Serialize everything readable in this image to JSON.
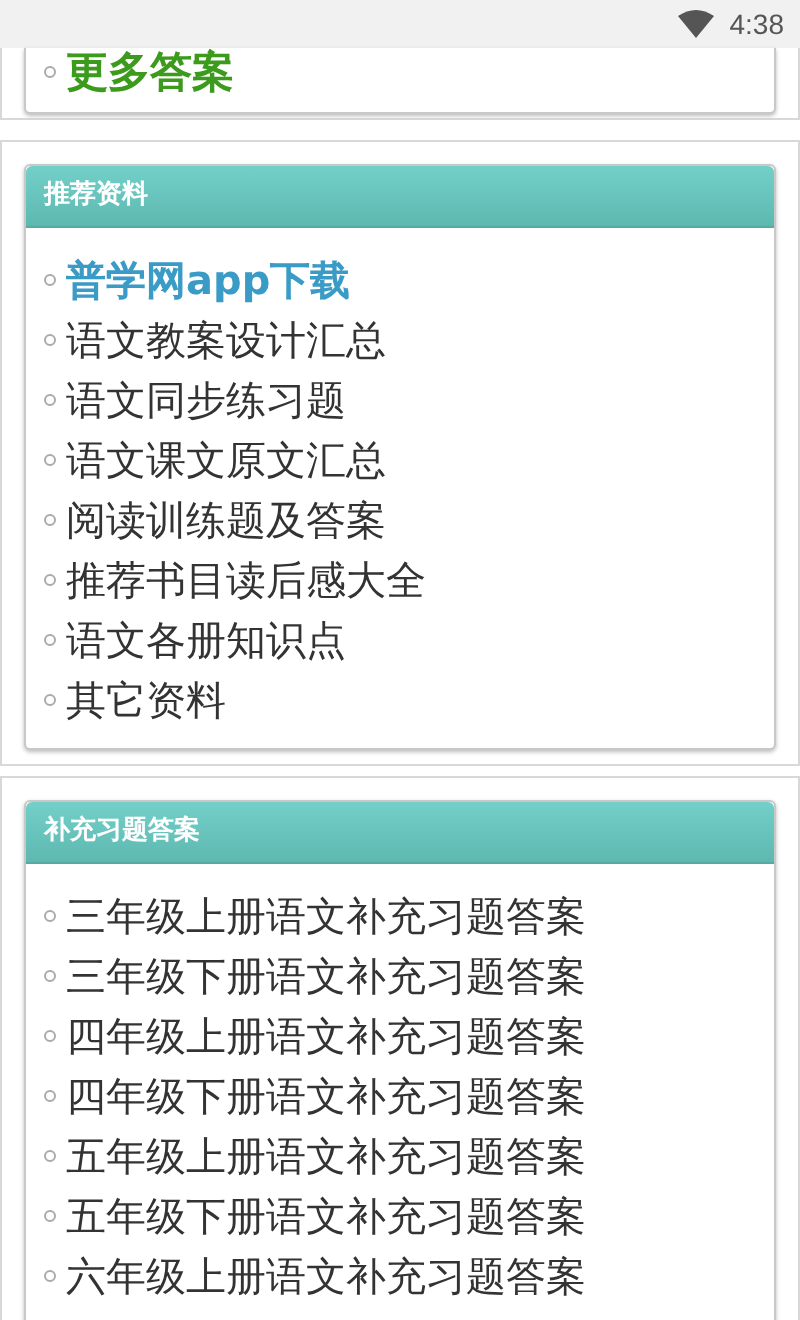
{
  "status_bar": {
    "time": "4:38"
  },
  "sections": [
    {
      "items": [
        {
          "label": "更多答案",
          "kind": "more"
        }
      ]
    },
    {
      "title": "推荐资料",
      "items": [
        {
          "label": "普学网app下载",
          "kind": "featured"
        },
        {
          "label": "语文教案设计汇总",
          "kind": "plain"
        },
        {
          "label": "语文同步练习题",
          "kind": "plain"
        },
        {
          "label": "语文课文原文汇总",
          "kind": "plain"
        },
        {
          "label": "阅读训练题及答案",
          "kind": "plain"
        },
        {
          "label": "推荐书目读后感大全",
          "kind": "plain"
        },
        {
          "label": "语文各册知识点",
          "kind": "plain"
        },
        {
          "label": "其它资料",
          "kind": "plain"
        }
      ]
    },
    {
      "title": "补充习题答案",
      "items": [
        {
          "label": "三年级上册语文补充习题答案",
          "kind": "plain"
        },
        {
          "label": "三年级下册语文补充习题答案",
          "kind": "plain"
        },
        {
          "label": "四年级上册语文补充习题答案",
          "kind": "plain"
        },
        {
          "label": "四年级下册语文补充习题答案",
          "kind": "plain"
        },
        {
          "label": "五年级上册语文补充习题答案",
          "kind": "plain"
        },
        {
          "label": "五年级下册语文补充习题答案",
          "kind": "plain"
        },
        {
          "label": "六年级上册语文补充习题答案",
          "kind": "plain"
        }
      ]
    }
  ]
}
